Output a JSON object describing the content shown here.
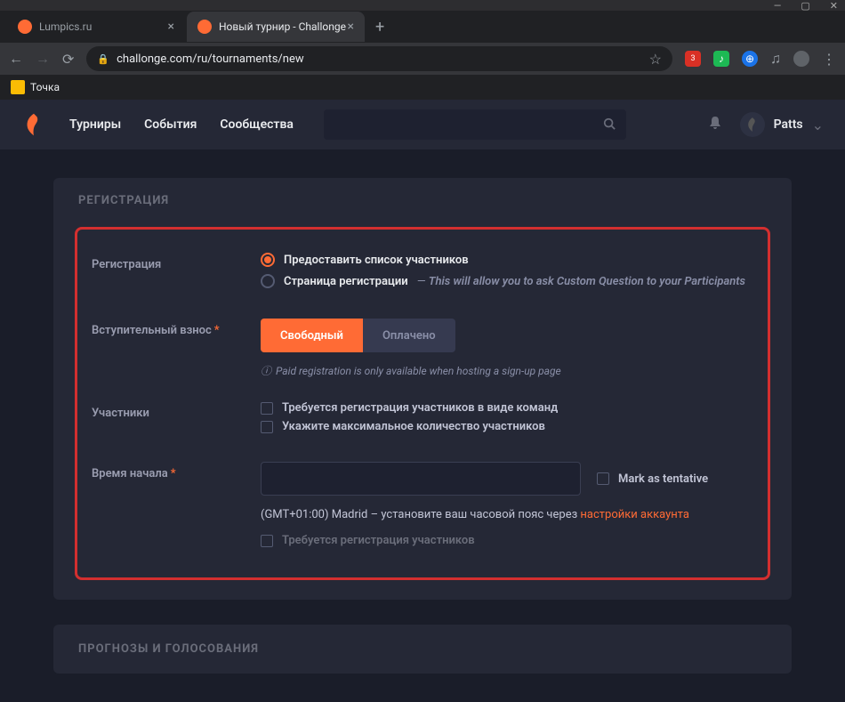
{
  "browser": {
    "tabs": [
      {
        "title": "Lumpics.ru",
        "active": false,
        "favicon_color": "#ff6b35"
      },
      {
        "title": "Новый турнир - Challonge",
        "active": true,
        "favicon_color": "#ff6b35"
      }
    ],
    "url": "challonge.com/ru/tournaments/new",
    "bookmarks": [
      {
        "label": "Точка"
      }
    ]
  },
  "header": {
    "nav": [
      "Турниры",
      "События",
      "Сообщества"
    ],
    "user": "Patts"
  },
  "panel": {
    "title": "РЕГИСТРАЦИЯ",
    "rows": {
      "registration": {
        "label": "Регистрация",
        "opt1": "Предоставить список участников",
        "opt2_label": "Страница регистрации",
        "opt2_desc": "This will allow you to ask Custom Question to your Participants"
      },
      "fee": {
        "label": "Вступительный взнос",
        "btn_free": "Свободный",
        "btn_paid": "Оплачено",
        "note": "Paid registration is only available when hosting a sign-up page"
      },
      "participants": {
        "label": "Участники",
        "chk1": "Требуется регистрация участников в виде команд",
        "chk2": "Укажите максимальное количество участников"
      },
      "start_time": {
        "label": "Время начала",
        "tentative": "Mark as tentative",
        "tz_prefix": "(GMT+01:00) Madrid – установите ваш часовой пояс через ",
        "tz_link": "настройки аккаунта",
        "chk": "Требуется регистрация участников"
      }
    }
  },
  "panel2": {
    "title": "ПРОГНОЗЫ И ГОЛОСОВАНИЯ"
  }
}
